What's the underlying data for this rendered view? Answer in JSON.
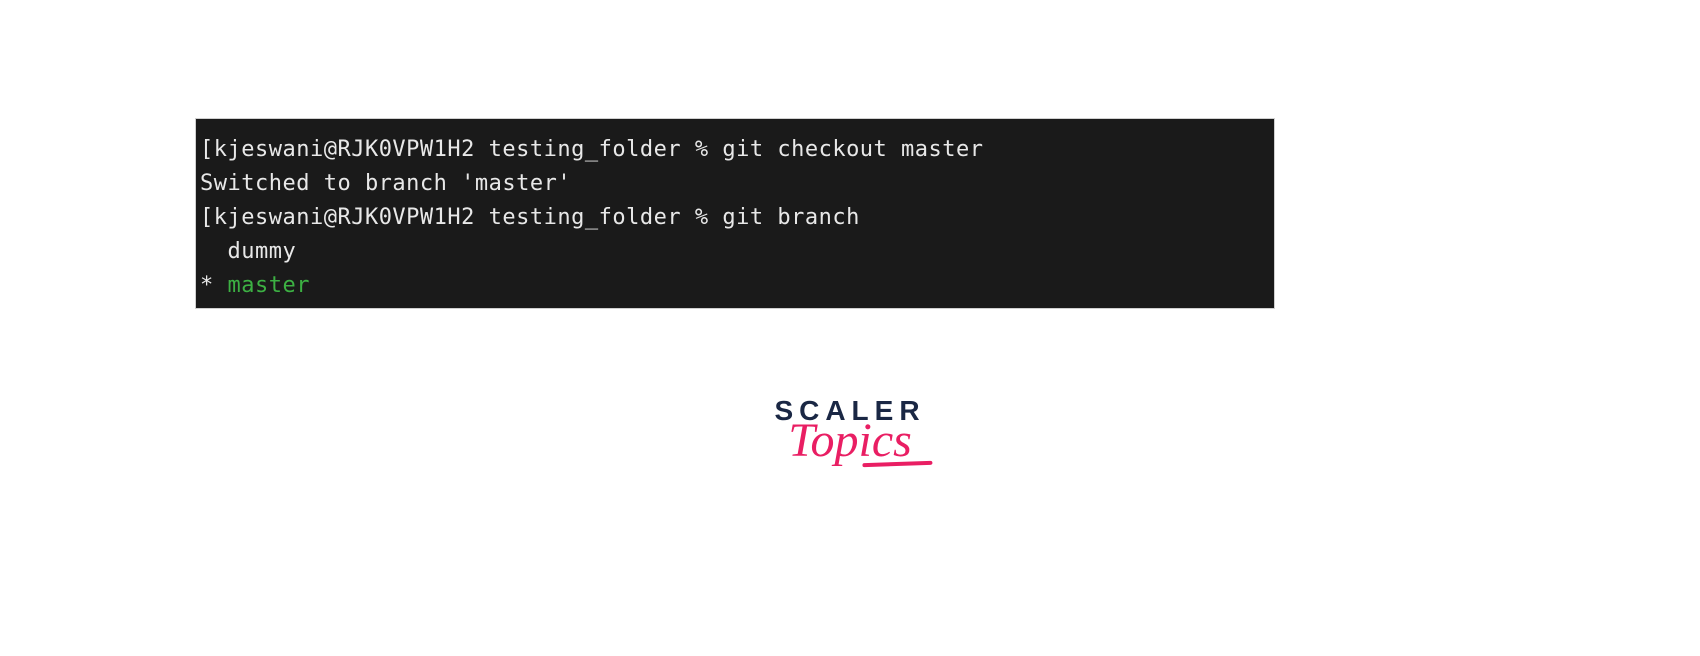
{
  "terminal": {
    "lines": [
      {
        "type": "truncated",
        "text": ""
      },
      {
        "type": "prompt",
        "bracket": "[",
        "user_host": "kjeswani@RJK0VPW1H2",
        "path": "testing_folder",
        "symbol": "%",
        "command": "git checkout master"
      },
      {
        "type": "output",
        "text": "Switched to branch 'master'"
      },
      {
        "type": "prompt",
        "bracket": "[",
        "user_host": "kjeswani@RJK0VPW1H2",
        "path": "testing_folder",
        "symbol": "%",
        "command": "git branch"
      },
      {
        "type": "branch",
        "marker": "  ",
        "name": "dummy",
        "current": false
      },
      {
        "type": "branch",
        "marker": "* ",
        "name": "master",
        "current": true
      }
    ]
  },
  "logo": {
    "line1": "SCALER",
    "line2": "Topics"
  },
  "colors": {
    "terminal_bg": "#1a1a1a",
    "terminal_fg": "#e8e8e8",
    "branch_current": "#3cb043",
    "logo_dark": "#1a2744",
    "logo_pink": "#e91e63"
  }
}
